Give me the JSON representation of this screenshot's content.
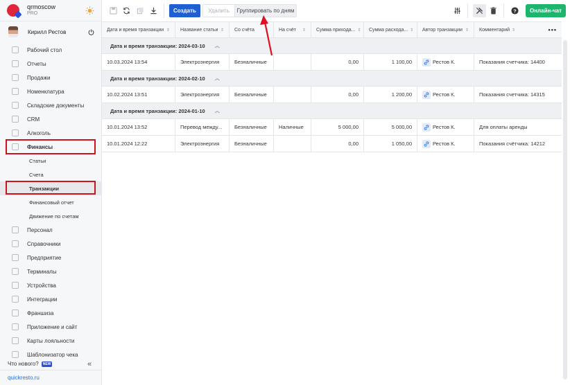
{
  "brand": {
    "name": "qrmoscow",
    "plan": "PRO"
  },
  "user": {
    "name": "Кирилл Рестов"
  },
  "nav": {
    "items": [
      {
        "label": "Рабочий стол",
        "icon": "dashboard-icon"
      },
      {
        "label": "Отчеты",
        "icon": "reports-icon"
      },
      {
        "label": "Продажи",
        "icon": "sales-icon"
      },
      {
        "label": "Номенклатура",
        "icon": "nomenclature-icon"
      },
      {
        "label": "Складские документы",
        "icon": "warehouse-icon"
      },
      {
        "label": "CRM",
        "icon": "crm-icon"
      },
      {
        "label": "Алкоголь",
        "icon": "alcohol-icon"
      },
      {
        "label": "Финансы",
        "icon": "finance-icon"
      }
    ],
    "finance_sub": [
      "Статьи",
      "Счета",
      "Транзакции",
      "Финансовый отчет",
      "Движение по счетам"
    ],
    "items_after": [
      {
        "label": "Персонал",
        "icon": "staff-icon"
      },
      {
        "label": "Справочники",
        "icon": "directory-icon"
      },
      {
        "label": "Предприятие",
        "icon": "enterprise-icon"
      },
      {
        "label": "Терминалы",
        "icon": "terminal-icon"
      },
      {
        "label": "Устройства",
        "icon": "device-icon"
      },
      {
        "label": "Интеграции",
        "icon": "integration-icon"
      },
      {
        "label": "Франшиза",
        "icon": "franchise-icon"
      },
      {
        "label": "Приложение и сайт",
        "icon": "app-icon"
      },
      {
        "label": "Карты лояльности",
        "icon": "loyalty-icon"
      },
      {
        "label": "Шаблонизатор чека",
        "icon": "receipt-icon"
      }
    ],
    "whats_new": "Что нового?",
    "new_badge": "NEW",
    "footer_link": "quickresto.ru"
  },
  "toolbar": {
    "create": "Создать",
    "delete": "Удалить",
    "group_by_days": "Группировать по дням",
    "online_chat": "Онлайн-чат"
  },
  "table": {
    "columns": [
      "Дата и время транзакции",
      "Название статьи",
      "Со счёта",
      "На счёт",
      "Сумма прихода...",
      "Сумма расхода...",
      "Автор транзакции",
      "Комментарий"
    ],
    "groups": [
      {
        "title": "Дата и время транзакции: 2024-03-10",
        "rows": [
          [
            "10.03.2024 13:54",
            "Электроэнергия",
            "Безналичные",
            "",
            "0,00",
            "1 100,00",
            "Рестов К.",
            "Показания счетчика: 14400"
          ]
        ]
      },
      {
        "title": "Дата и время транзакции: 2024-02-10",
        "rows": [
          [
            "10.02.2024 13:51",
            "Электроэнергия",
            "Безналичные",
            "",
            "0,00",
            "1 200,00",
            "Рестов К.",
            "Показания счетчика: 14315"
          ]
        ]
      },
      {
        "title": "Дата и время транзакции: 2024-01-10",
        "rows": [
          [
            "10.01.2024 13:52",
            "Перевод между...",
            "Безналичные",
            "Наличные",
            "5 000,00",
            "5 000,00",
            "Рестов К.",
            "Для оплаты аренды"
          ],
          [
            "10.01.2024 12:22",
            "Электроэнергия",
            "Безналичные",
            "",
            "0,00",
            "1 050,00",
            "Рестов К.",
            "Показания счётчика: 14212"
          ]
        ]
      }
    ]
  },
  "colors": {
    "primary": "#1f5fd1",
    "chat": "#1db56b",
    "highlight": "#d0121e",
    "brand": "#e0263c"
  }
}
